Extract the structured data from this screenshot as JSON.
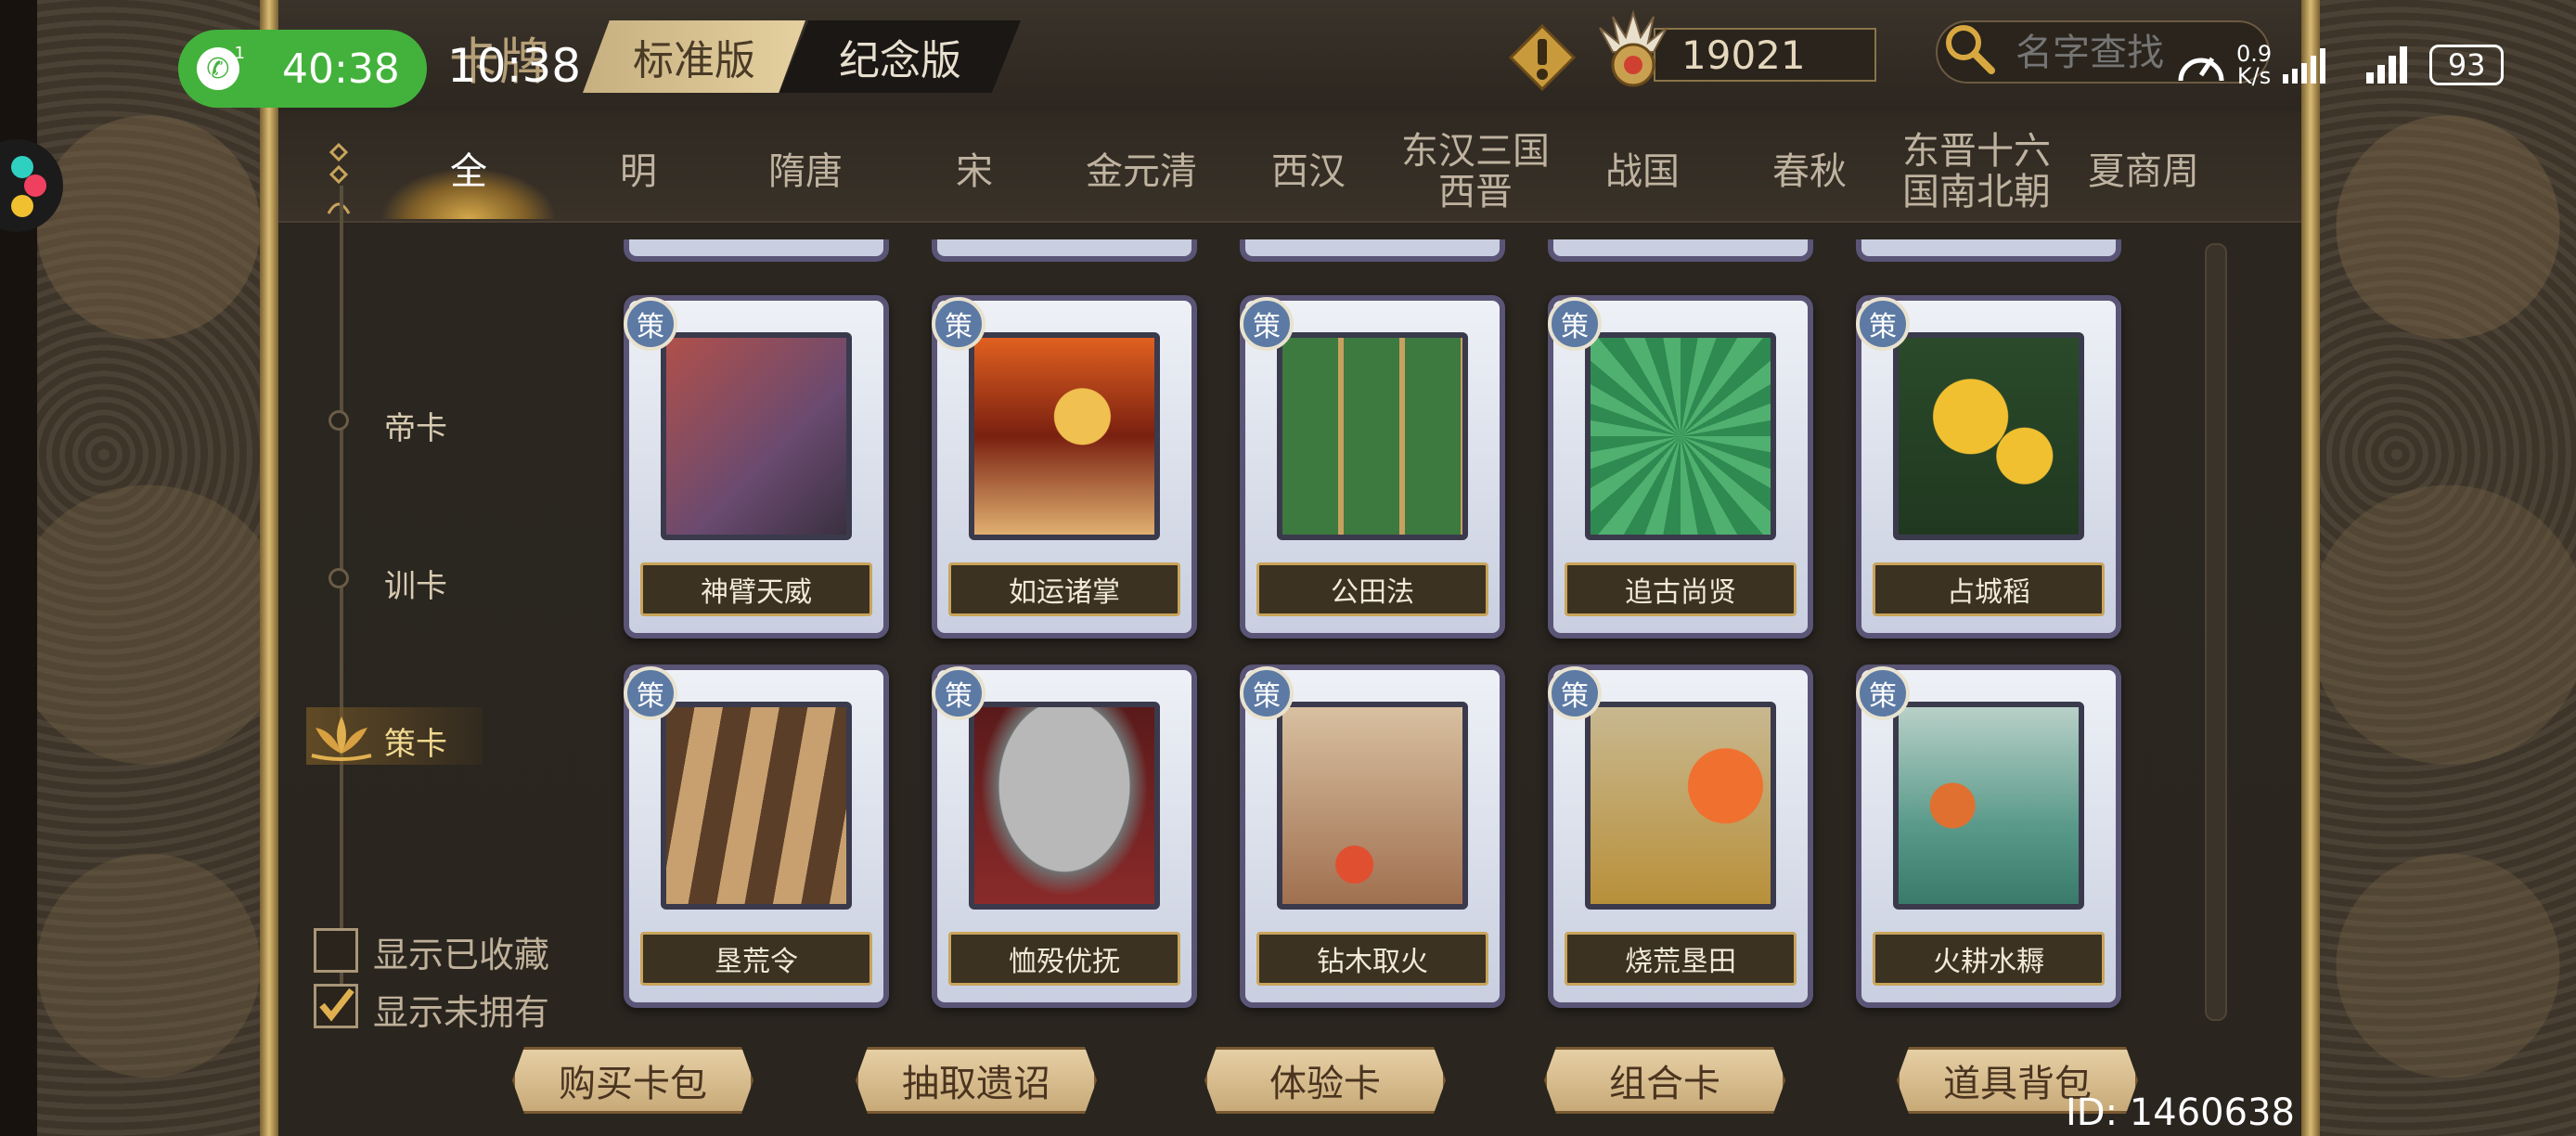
{
  "status_bar": {
    "call_timer": "40:38",
    "call_sim": "1",
    "clock": "10:38",
    "net_speed_value": "0.9",
    "net_speed_unit": "K/s",
    "battery": "93"
  },
  "header": {
    "title": "卡牌",
    "edition_tabs": [
      "标准版",
      "纪念版"
    ],
    "coins": "19021",
    "search_placeholder": "名字查找"
  },
  "era_tabs": [
    {
      "label": "全",
      "active": true
    },
    {
      "label": "明"
    },
    {
      "label": "隋唐"
    },
    {
      "label": "宋"
    },
    {
      "label": "金元清"
    },
    {
      "label": "西汉"
    },
    {
      "label": "东汉三国\n西晋"
    },
    {
      "label": "战国"
    },
    {
      "label": "春秋"
    },
    {
      "label": "东晋十六\n国南北朝"
    },
    {
      "label": "夏商周"
    }
  ],
  "categories": [
    {
      "label": "帝卡"
    },
    {
      "label": "训卡"
    },
    {
      "label": "策卡",
      "active": true
    }
  ],
  "filters": {
    "show_collected": {
      "label": "显示已收藏",
      "checked": false
    },
    "show_unowned": {
      "label": "显示未拥有",
      "checked": true
    }
  },
  "card_badge": "策",
  "cards": [
    {
      "name": "神臂天威",
      "art": "crossbow-soldier"
    },
    {
      "name": "如运诸掌",
      "art": "coins-in-hand"
    },
    {
      "name": "公田法",
      "art": "green-field"
    },
    {
      "name": "追古尚贤",
      "art": "hands-spiral"
    },
    {
      "name": "占城稻",
      "art": "rice-ears"
    },
    {
      "name": "垦荒令",
      "art": "plowed-land"
    },
    {
      "name": "恤殁优抚",
      "art": "helmet"
    },
    {
      "name": "钻木取火",
      "art": "fire-drill"
    },
    {
      "name": "烧荒垦田",
      "art": "burning-field"
    },
    {
      "name": "火耕水耨",
      "art": "terraced-fields"
    }
  ],
  "bottom_buttons": [
    "购买卡包",
    "抽取遗诏",
    "体验卡",
    "组合卡",
    "道具背包"
  ],
  "user_id": "ID: 1460638",
  "colors": {
    "accent_gold": "#d4a84a",
    "call_green": "#43b23c",
    "badge_blue": "#5c7aa4",
    "card_frame": "#5a5476"
  }
}
